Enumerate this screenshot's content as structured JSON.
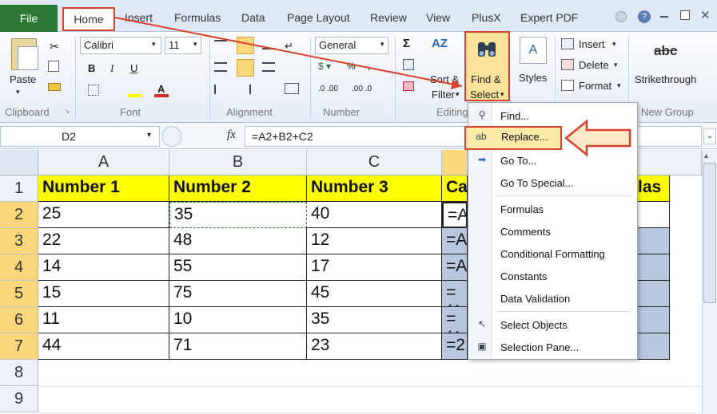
{
  "tabs": {
    "file": "File",
    "home": "Home",
    "insert": "Insert",
    "formulas": "Formulas",
    "data": "Data",
    "page_layout": "Page Layout",
    "review": "Review",
    "view": "View",
    "plusx": "PlusX",
    "expert_pdf": "Expert PDF"
  },
  "ribbon": {
    "paste": "Paste",
    "font_name": "Calibri",
    "font_size": "11",
    "number_format": "General",
    "sort_filter_line1": "Sort &",
    "sort_filter_line2": "Filter",
    "find_select_line1": "Find &",
    "find_select_line2": "Select",
    "styles": "Styles",
    "insert": "Insert",
    "delete": "Delete",
    "format": "Format",
    "strikethrough_icon_text": "abc",
    "strikethrough": "Strikethrough",
    "groups": {
      "clipboard": "Clipboard",
      "font": "Font",
      "alignment": "Alignment",
      "number": "Number",
      "editing": "Editing",
      "new_group": "New Group"
    }
  },
  "formula_bar": {
    "name_box": "D2",
    "fx": "fx",
    "formula": "=A2+B2+C2"
  },
  "grid": {
    "columns": [
      "A",
      "B",
      "C"
    ],
    "col_d_partial": "",
    "rows": [
      "1",
      "2",
      "3",
      "4",
      "5",
      "6",
      "7",
      "8",
      "9"
    ],
    "header": [
      "Number 1",
      "Number 2",
      "Number 3",
      "Ca",
      "las"
    ],
    "data": [
      [
        "25",
        "35",
        "40",
        "=A"
      ],
      [
        "22",
        "48",
        "12",
        "=A"
      ],
      [
        "14",
        "55",
        "17",
        "=A"
      ],
      [
        "15",
        "75",
        "45",
        "=(A"
      ],
      [
        "11",
        "10",
        "35",
        "=(A"
      ],
      [
        "44",
        "71",
        "23",
        "=2"
      ]
    ]
  },
  "menu": {
    "find": "Find...",
    "replace": "Replace...",
    "goto": "Go To...",
    "goto_special": "Go To Special...",
    "formulas": "Formulas",
    "comments": "Comments",
    "conditional_formatting": "Conditional Formatting",
    "constants": "Constants",
    "data_validation": "Data Validation",
    "select_objects": "Select Objects",
    "selection_pane": "Selection Pane..."
  },
  "colors": {
    "file_tab": "#2a7a34",
    "annotation_red": "#d8412c",
    "header_yellow": "#ffff00",
    "selected_header": "#f9d77a",
    "selection_blue": "#b7c7dd"
  }
}
